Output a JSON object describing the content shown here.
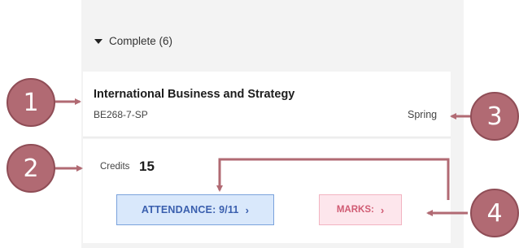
{
  "section": {
    "header": "Complete (6)"
  },
  "module": {
    "title": "International Business and Strategy",
    "code": "BE268-7-SP",
    "term": "Spring",
    "credits_label": "Credits",
    "credits_value": "15"
  },
  "actions": {
    "attendance_label": "ATTENDANCE: 9/11",
    "marks_label": "MARKS:",
    "chevron": "›"
  },
  "annotations": {
    "markers": [
      "1",
      "2",
      "3",
      "4"
    ],
    "color": "#b16a73"
  },
  "colors": {
    "attendance_bg": "#d9e8fb",
    "attendance_text": "#3a5fae",
    "marks_bg": "#fde6ec",
    "marks_text": "#d05b73"
  }
}
